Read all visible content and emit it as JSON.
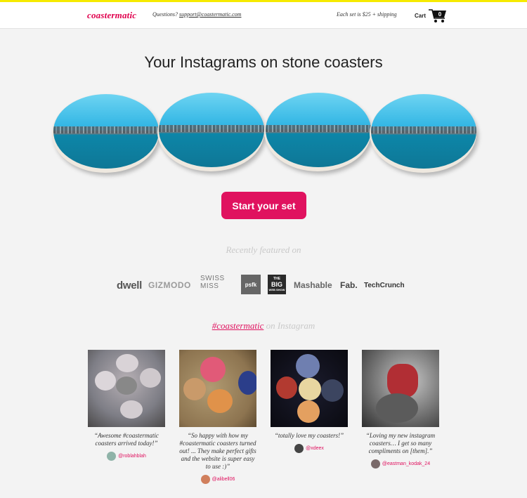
{
  "header": {
    "logo": "coastermatic",
    "questions_prefix": "Questions?",
    "support_email": "support@coastermatic.com",
    "price_note": "Each set is $25 + shipping",
    "cart_label": "Cart",
    "cart_count": "0"
  },
  "hero": {
    "headline": "Your Instagrams on stone coasters",
    "cta_label": "Start your set"
  },
  "press": {
    "label": "Recently featured on",
    "logos": {
      "dwell": "dwell",
      "gizmodo": "GIZMODO",
      "swissmiss_1": "SWISS",
      "swissmiss_2": "MISS",
      "psfk": "psfk",
      "bigwebshow_1": "THE",
      "bigwebshow_2": "BIG",
      "bigwebshow_3": "WEB SHOW",
      "mashable": "Mashable",
      "fab": "Fab.",
      "techcrunch": "TechCrunch"
    }
  },
  "instagram": {
    "hashtag": "#coastermatic",
    "suffix": "on Instagram",
    "posts": [
      {
        "quote": "“Awesome #coastermatic coasters arrived today!”",
        "handle": "@roblahblah"
      },
      {
        "quote": "“So happy with how my #coastermatic coasters turned out! ... They make perfect gifts and the website is super easy to use :)”",
        "handle": "@alibell06"
      },
      {
        "quote": "“totally love my coasters!”",
        "handle": "@xdeex"
      },
      {
        "quote": "“Loving my new instagram coasters… I get so many compliments on [them].”",
        "handle": "@eastman_kodak_24"
      }
    ]
  },
  "colors": {
    "accent": "#e0125f",
    "topbar": "#f6ea00",
    "background": "#f3f3f3"
  }
}
